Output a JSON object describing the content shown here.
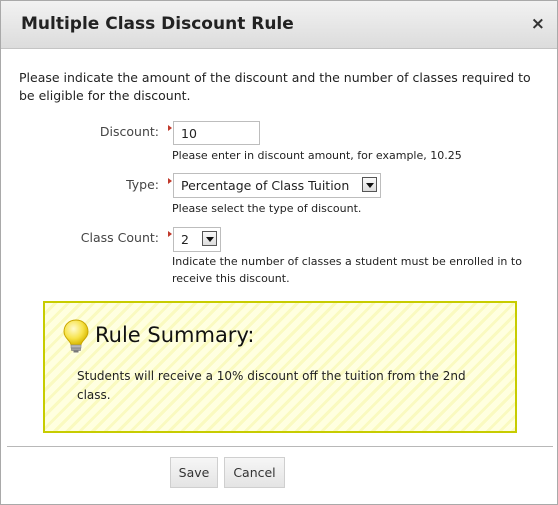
{
  "dialog": {
    "title": "Multiple Class Discount Rule",
    "close_glyph": "×"
  },
  "intro": "Please indicate the amount of the discount and the number of classes required to be eligible for the discount.",
  "form": {
    "discount": {
      "label": "Discount:",
      "value": "10",
      "help": "Please enter in discount amount, for example, 10.25"
    },
    "type": {
      "label": "Type:",
      "selected": "Percentage of Class Tuition",
      "help": "Please select the type of discount."
    },
    "class_count": {
      "label": "Class Count:",
      "selected": "2",
      "help": "Indicate the number of classes a student must be enrolled in to receive this discount."
    }
  },
  "summary": {
    "icon": "lightbulb-icon",
    "title": "Rule Summary:",
    "text": "Students will receive a 10% discount off the tuition from the 2nd class."
  },
  "buttons": {
    "save": "Save",
    "cancel": "Cancel"
  },
  "colors": {
    "required_marker": "#c0392b",
    "summary_border": "#c7cc00",
    "summary_bg": "#ffffe0"
  }
}
